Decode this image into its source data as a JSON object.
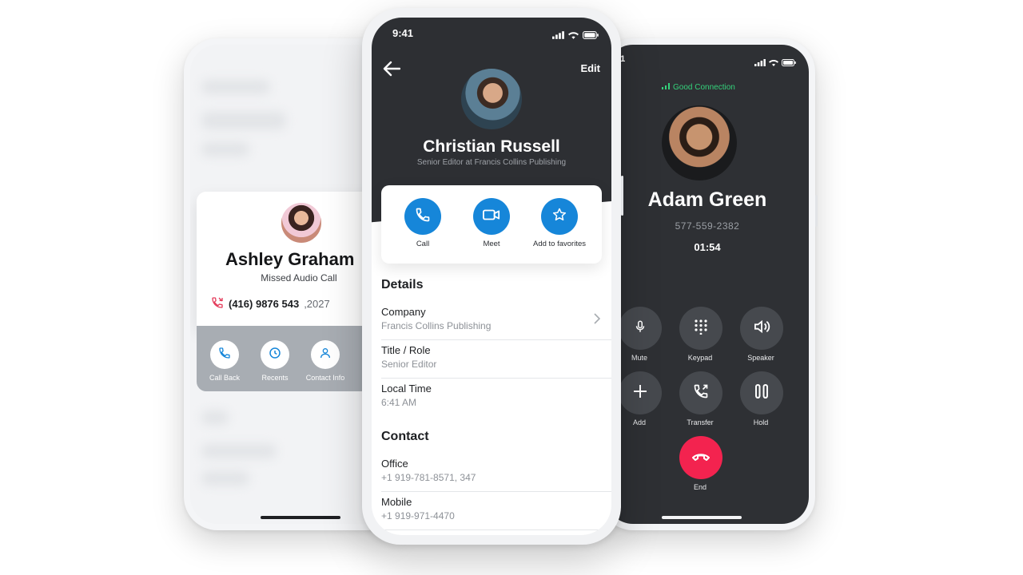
{
  "left_phone": {
    "name": "Ashley Graham",
    "subtitle": "Missed Audio Call",
    "number_main": "(416) 9876 543",
    "number_ext": ",2027",
    "actions": [
      {
        "label": "Call Back",
        "icon": "phone-icon"
      },
      {
        "label": "Recents",
        "icon": "history-icon"
      },
      {
        "label": "Contact Info",
        "icon": "person-icon"
      }
    ],
    "colors": {
      "accent": "#1686d9",
      "missed": "#e43d5c"
    }
  },
  "center_phone": {
    "status_time": "9:41",
    "edit_label": "Edit",
    "name": "Christian Russell",
    "subtitle": "Senior Editor at Francis Collins Publishing",
    "actions": [
      {
        "label": "Call",
        "icon": "phone-icon"
      },
      {
        "label": "Meet",
        "icon": "video-icon"
      },
      {
        "label": "Add to favorites",
        "icon": "star-icon"
      }
    ],
    "details_title": "Details",
    "details": [
      {
        "label": "Company",
        "value": "Francis Collins Publishing"
      },
      {
        "label": "Title / Role",
        "value": "Senior Editor"
      },
      {
        "label": "Local Time",
        "value": "6:41 AM"
      }
    ],
    "contact_title": "Contact",
    "contact": [
      {
        "label": "Office",
        "value": "+1 919-781-8571, 347"
      },
      {
        "label": "Mobile",
        "value": "+1 919-971-4470"
      }
    ],
    "colors": {
      "header": "#2d2f33",
      "accent": "#1686d9"
    }
  },
  "right_phone": {
    "status_time": "41",
    "connection": "Good Connection",
    "name": "Adam Green",
    "number": "577-559-2382",
    "timer": "01:54",
    "controls": [
      {
        "label": "Mute",
        "icon": "microphone-icon"
      },
      {
        "label": "Keypad",
        "icon": "keypad-icon"
      },
      {
        "label": "Speaker",
        "icon": "speaker-icon"
      },
      {
        "label": "Add",
        "icon": "plus-icon"
      },
      {
        "label": "Transfer",
        "icon": "transfer-icon"
      },
      {
        "label": "Hold",
        "icon": "pause-icon"
      }
    ],
    "end_label": "End",
    "colors": {
      "background": "#2e3034",
      "connection": "#34d27b",
      "end": "#f3234f"
    }
  }
}
